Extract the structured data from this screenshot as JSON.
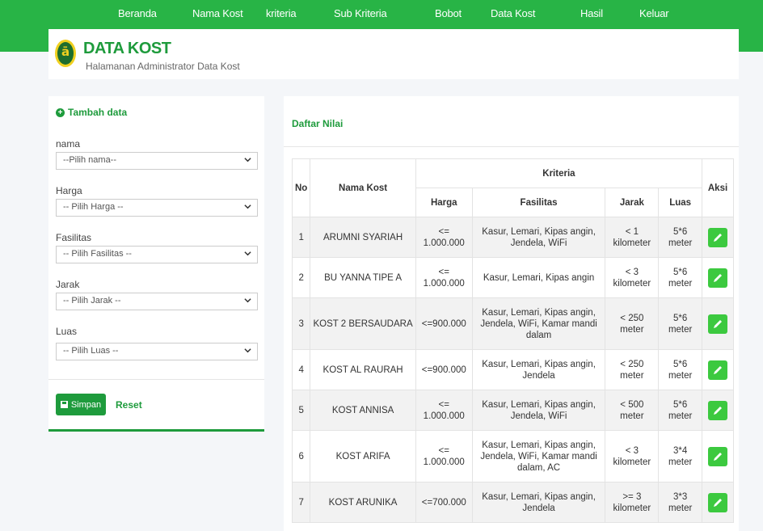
{
  "nav": [
    "Beranda",
    "Nama Kost",
    "kriteria",
    "Sub Kriteria",
    "Bobot",
    "Data Kost",
    "Hasil",
    "Keluar"
  ],
  "header": {
    "title": "DATA KOST",
    "subtitle": "Halamanan Administrator Data Kost"
  },
  "form": {
    "add_label": "Tambah data",
    "fields": [
      {
        "label": "nama",
        "selected": "--Pilih nama--"
      },
      {
        "label": "Harga",
        "selected": "-- Pilih Harga --"
      },
      {
        "label": "Fasilitas",
        "selected": "-- Pilih Fasilitas --"
      },
      {
        "label": "Jarak",
        "selected": "-- Pilih Jarak --"
      },
      {
        "label": "Luas",
        "selected": "-- Pilih Luas --"
      }
    ],
    "save_label": "Simpan",
    "reset_label": "Reset"
  },
  "table": {
    "title": "Daftar Nilai",
    "headers": {
      "no": "No",
      "nama": "Nama Kost",
      "kriteria": "Kriteria",
      "harga": "Harga",
      "fasilitas": "Fasilitas",
      "jarak": "Jarak",
      "luas": "Luas",
      "aksi": "Aksi"
    },
    "rows": [
      {
        "no": "1",
        "nama": "ARUMNI SYARIAH",
        "harga": "<= 1.000.000",
        "fasilitas": "Kasur, Lemari, Kipas angin, Jendela, WiFi",
        "jarak": "< 1 kilometer",
        "luas": "5*6 meter"
      },
      {
        "no": "2",
        "nama": "BU YANNA TIPE A",
        "harga": "<= 1.000.000",
        "fasilitas": "Kasur, Lemari, Kipas angin",
        "jarak": "< 3 kilometer",
        "luas": "5*6 meter"
      },
      {
        "no": "3",
        "nama": "KOST 2 BERSAUDARA",
        "harga": "<=900.000",
        "fasilitas": "Kasur, Lemari, Kipas angin, Jendela, WiFi, Kamar mandi dalam",
        "jarak": "< 250 meter",
        "luas": "5*6 meter"
      },
      {
        "no": "4",
        "nama": "KOST AL RAURAH",
        "harga": "<=900.000",
        "fasilitas": "Kasur, Lemari, Kipas angin, Jendela",
        "jarak": "< 250 meter",
        "luas": "5*6 meter"
      },
      {
        "no": "5",
        "nama": "KOST ANNISA",
        "harga": "<= 1.000.000",
        "fasilitas": "Kasur, Lemari, Kipas angin, Jendela, WiFi",
        "jarak": "< 500 meter",
        "luas": "5*6 meter"
      },
      {
        "no": "6",
        "nama": "KOST ARIFA",
        "harga": "<= 1.000.000",
        "fasilitas": "Kasur, Lemari, Kipas angin, Jendela, WiFi, Kamar mandi dalam, AC",
        "jarak": "< 3 kilometer",
        "luas": "3*4 meter"
      },
      {
        "no": "7",
        "nama": "KOST ARUNIKA",
        "harga": "<=700.000",
        "fasilitas": "Kasur, Lemari, Kipas angin, Jendela",
        "jarak": ">= 3 kilometer",
        "luas": "3*3 meter"
      }
    ]
  },
  "colors": {
    "primary": "#28b446",
    "accent": "#1e9b3c",
    "edit_button": "#3cc93f"
  },
  "icons": {
    "logo": "logo-icon",
    "add": "plus-circle-icon",
    "save": "floppy-disk-icon",
    "edit": "pencil-icon",
    "dropdown": "chevron-down-icon"
  }
}
